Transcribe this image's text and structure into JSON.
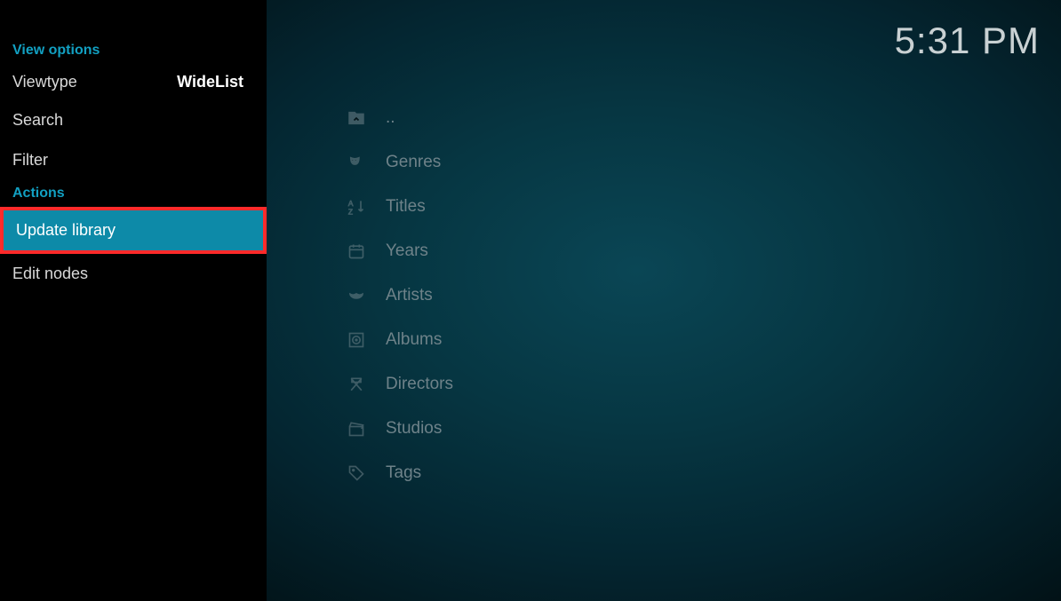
{
  "clock": "5:31 PM",
  "sidebar": {
    "section1_title": "View options",
    "viewtype_label": "Viewtype",
    "viewtype_value": "WideList",
    "search_label": "Search",
    "filter_label": "Filter",
    "section2_title": "Actions",
    "update_library_label": "Update library",
    "edit_nodes_label": "Edit nodes"
  },
  "list": {
    "parent": "..",
    "genres": "Genres",
    "titles": "Titles",
    "years": "Years",
    "artists": "Artists",
    "albums": "Albums",
    "directors": "Directors",
    "studios": "Studios",
    "tags": "Tags"
  }
}
